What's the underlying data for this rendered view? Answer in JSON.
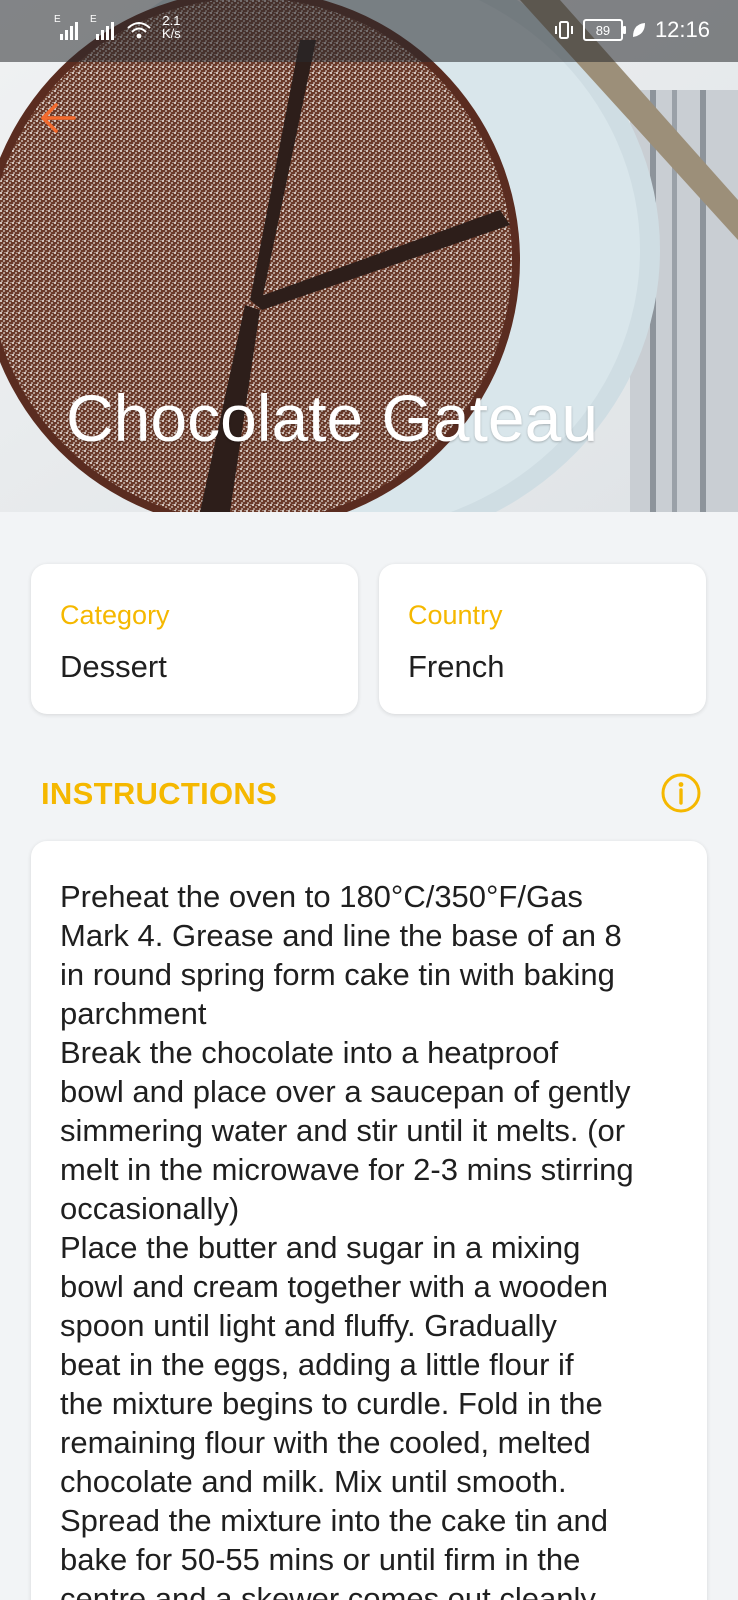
{
  "status_bar": {
    "signal_1_label": "E",
    "signal_2_label": "E",
    "net_speed_value": "2.1",
    "net_speed_unit": "K/s",
    "battery_level": "89",
    "time": "12:16"
  },
  "header": {
    "back_icon": "arrow-left-icon",
    "title": "Chocolate Gateau"
  },
  "meal_info": {
    "category_label": "Category",
    "category_value": "Dessert",
    "country_label": "Country",
    "country_value": "French"
  },
  "instructions": {
    "heading": "INSTRUCTIONS",
    "info_icon": "info-circle-icon",
    "text": "Preheat the oven to 180°C/350°F/Gas\nMark 4. Grease and line the base of an 8\nin round spring form cake tin with baking\nparchment\nBreak the chocolate into a heatproof\nbowl and place over a saucepan of gently\nsimmering water and stir until it melts. (or\nmelt in the microwave for 2-3 mins stirring\noccasionally)\nPlace the butter and sugar in a mixing\nbowl and cream together with a wooden\nspoon until light and fluffy. Gradually\nbeat in the eggs, adding a little flour if\nthe mixture begins to curdle. Fold in the\nremaining flour with the cooled, melted\nchocolate and milk. Mix until smooth.\nSpread the mixture into the cake tin and\nbake for 50-55 mins or until firm in the\ncentre and a skewer comes out cleanly."
  },
  "colors": {
    "accent": "#f5b800",
    "back_arrow": "#f26a2e",
    "card_background": "#ffffff",
    "page_background": "#f2f4f6"
  }
}
